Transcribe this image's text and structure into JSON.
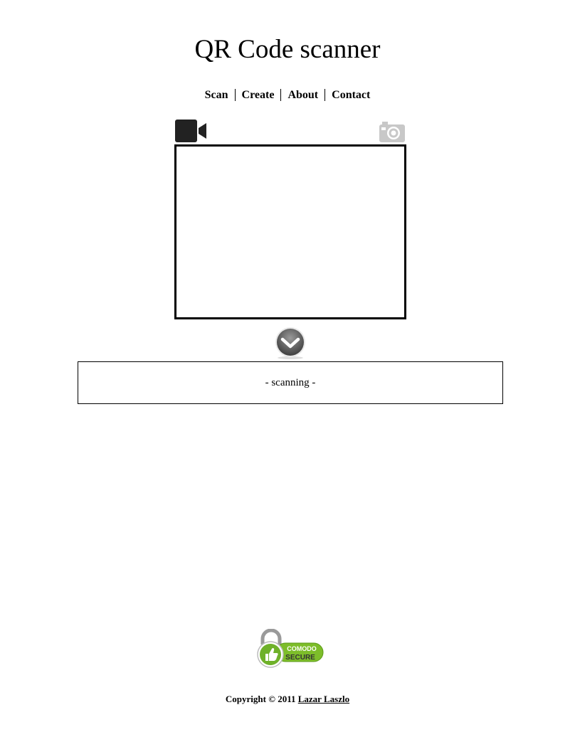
{
  "page": {
    "title": "QR Code scanner"
  },
  "nav": {
    "items": [
      {
        "label": "Scan"
      },
      {
        "label": "Create"
      },
      {
        "label": "About"
      },
      {
        "label": "Contact"
      }
    ]
  },
  "icons": {
    "video_camera": "video-camera-icon",
    "photo_camera": "photo-camera-icon",
    "scan_down": "chevron-down-icon"
  },
  "result": {
    "status_text": "- scanning -"
  },
  "badge": {
    "brand": "COMODO",
    "label": "SECURE"
  },
  "footer": {
    "copyright_text": "Copyright © 2011",
    "author_link": "Lazar Laszlo"
  },
  "colors": {
    "badge_green": "#7dbd2a",
    "icon_dark": "#222222",
    "icon_light": "#c8c8c8"
  }
}
